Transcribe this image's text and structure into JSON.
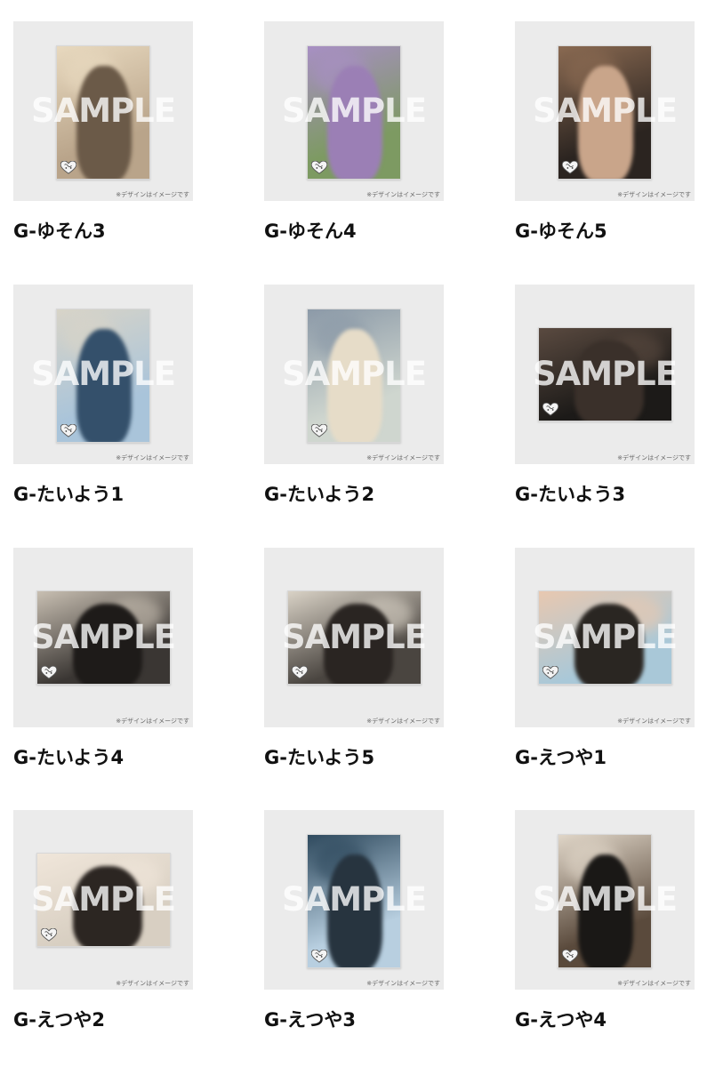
{
  "watermark_text": "SAMPLE",
  "note_text": "※デザインはイメージです",
  "products": [
    {
      "label": "G-ゆそん3",
      "orientation": "portrait",
      "bg": "#b9a48a",
      "accent": "#e8d9bf",
      "figure": "#6b5a48"
    },
    {
      "label": "G-ゆそん4",
      "orientation": "portrait",
      "bg": "#7d9a62",
      "accent": "#a88fc4",
      "figure": "#9b7fb5"
    },
    {
      "label": "G-ゆそん5",
      "orientation": "portrait",
      "bg": "#2b2420",
      "accent": "#8a6a52",
      "figure": "#c9a58a"
    },
    {
      "label": "G-たいよう1",
      "orientation": "portrait",
      "bg": "#a9c4da",
      "accent": "#d8d4c8",
      "figure": "#34506b"
    },
    {
      "label": "G-たいよう2",
      "orientation": "portrait",
      "bg": "#cfd6cf",
      "accent": "#8c9aa8",
      "figure": "#e6dcc8"
    },
    {
      "label": "G-たいよう3",
      "orientation": "landscape",
      "bg": "#1c1a18",
      "accent": "#5a4a40",
      "figure": "#3a302a"
    },
    {
      "label": "G-たいよう4",
      "orientation": "landscape",
      "bg": "#3a3633",
      "accent": "#c8bfb2",
      "figure": "#1e1b19"
    },
    {
      "label": "G-たいよう5",
      "orientation": "landscape",
      "bg": "#4a4540",
      "accent": "#d9d2c6",
      "figure": "#2a2522"
    },
    {
      "label": "G-えつや1",
      "orientation": "landscape",
      "bg": "#a9c8d8",
      "accent": "#e8c8b0",
      "figure": "#2a2622"
    },
    {
      "label": "G-えつや2",
      "orientation": "landscape",
      "bg": "#d8cfc2",
      "accent": "#f0e6da",
      "figure": "#2c2622"
    },
    {
      "label": "G-えつや3",
      "orientation": "portrait",
      "bg": "#b8cfe0",
      "accent": "#2f4a5e",
      "figure": "#27343f"
    },
    {
      "label": "G-えつや4",
      "orientation": "portrait",
      "bg": "#5a4a3c",
      "accent": "#e0d6c8",
      "figure": "#1a1816"
    }
  ]
}
